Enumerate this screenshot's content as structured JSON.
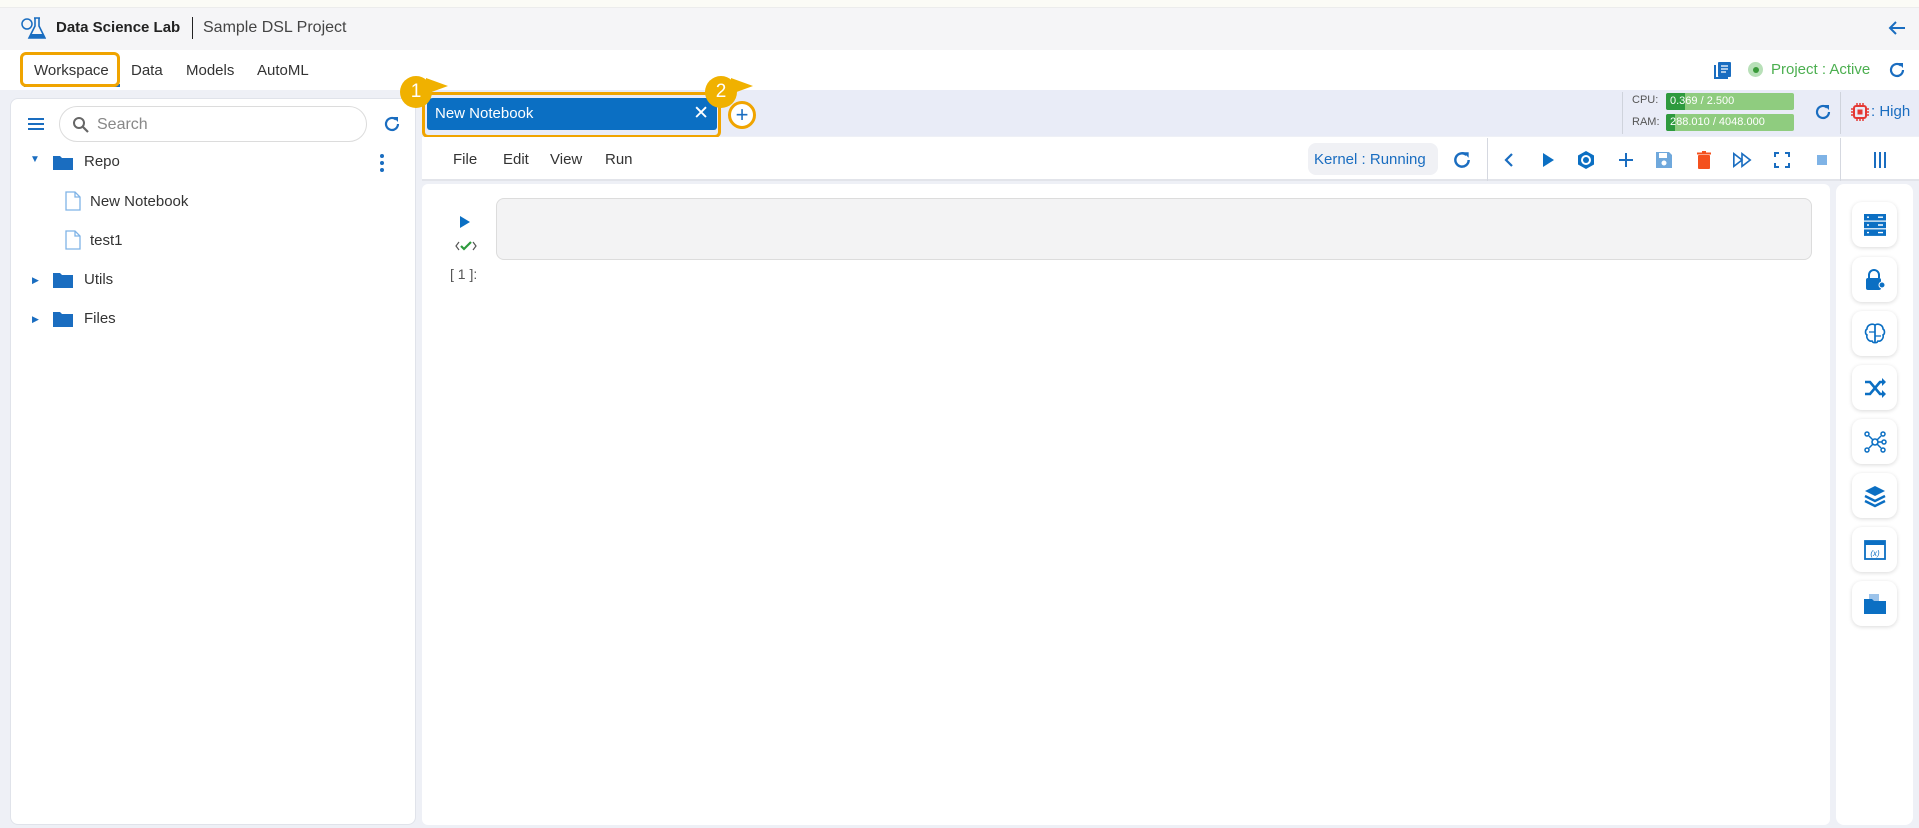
{
  "header": {
    "app_title": "Data Science Lab",
    "project_name": "Sample DSL Project"
  },
  "nav": {
    "tabs": [
      {
        "label": "Workspace",
        "active": true
      },
      {
        "label": "Data"
      },
      {
        "label": "Models"
      },
      {
        "label": "AutoML"
      }
    ],
    "project_status": "Project : Active"
  },
  "sidebar": {
    "search_placeholder": "Search",
    "tree": [
      {
        "label": "Repo",
        "type": "folder",
        "expanded": true
      },
      {
        "label": "New Notebook",
        "type": "file"
      },
      {
        "label": "test1",
        "type": "file"
      },
      {
        "label": "Utils",
        "type": "folder"
      },
      {
        "label": "Files",
        "type": "folder"
      }
    ]
  },
  "tabs": {
    "open": [
      {
        "label": "New Notebook"
      }
    ],
    "callouts": [
      "1",
      "2"
    ]
  },
  "resources": {
    "cpu_label": "CPU:",
    "cpu_value": "0.369 / 2.500",
    "cpu_fraction": 0.148,
    "ram_label": "RAM:",
    "ram_value": "288.010 / 4048.000",
    "ram_fraction": 0.071,
    "priority": ": High"
  },
  "toolbar": {
    "menus": [
      "File",
      "Edit",
      "View",
      "Run"
    ],
    "kernel_status": "Kernel : Running"
  },
  "cell": {
    "prompt": "[ 1 ]:"
  },
  "colors": {
    "accent": "#0b6fc3",
    "callout": "#f0b100",
    "status_green": "#4caf50",
    "delete": "#f4511e"
  },
  "right_sidebar": {
    "icons": [
      "data-server-icon",
      "secret-key-icon",
      "brain-icon",
      "shuffle-icon",
      "network-icon",
      "layers-icon",
      "variable-icon",
      "folder-files-icon"
    ]
  }
}
